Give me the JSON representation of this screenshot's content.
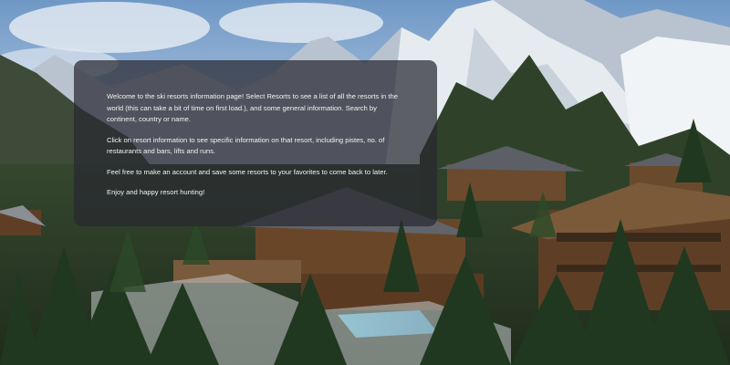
{
  "intro": {
    "paragraphs": [
      "Welcome to the ski resorts information page! Select Resorts to see a list of all the resorts in the world (this can take a bit of time on first load.), and some general information. Search by continent, country or name.",
      "Click on resort information to see specific information on that resort, including pistes, no. of restaurants and bars, lifts and runs.",
      "Feel free to make an account and save some resorts to your favorites to come back to later.",
      "Enjoy and happy resort hunting!"
    ]
  }
}
